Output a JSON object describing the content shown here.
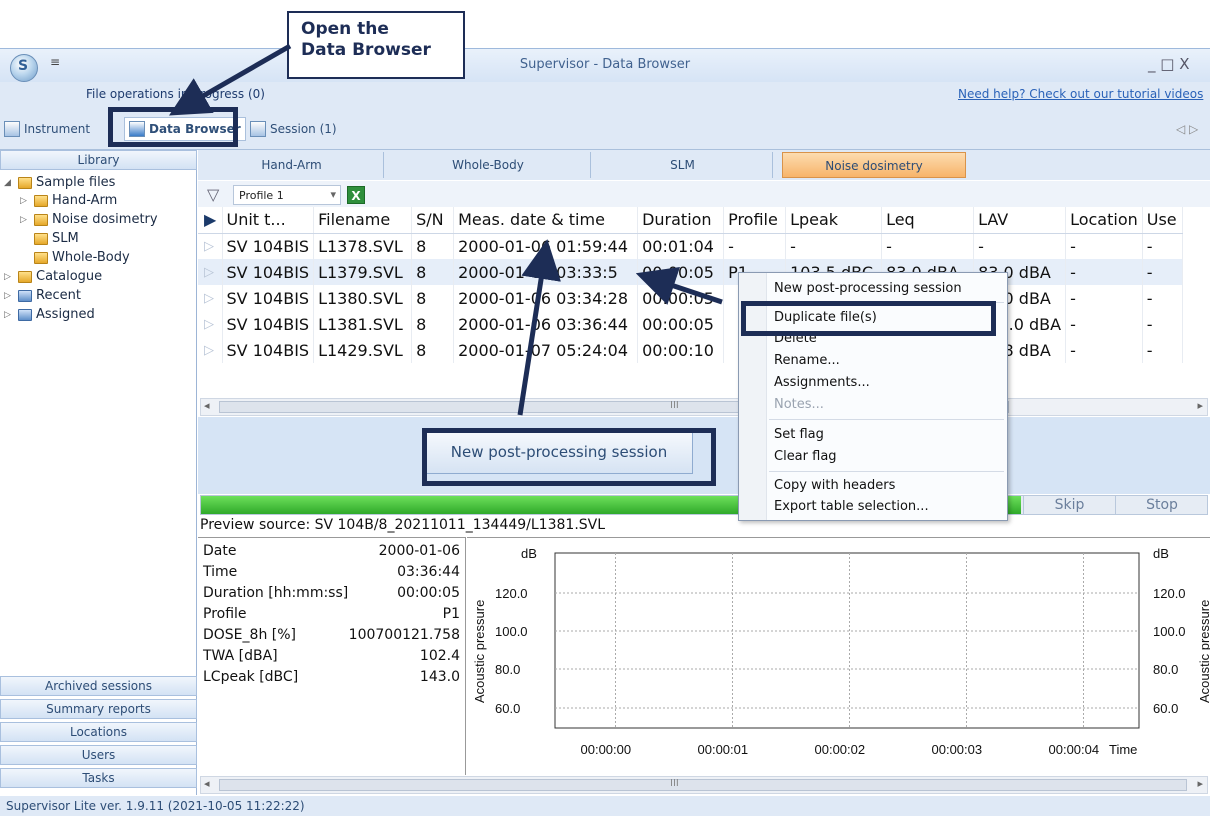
{
  "app": {
    "title": "Supervisor - Data Browser",
    "app_button_glyph": "S",
    "quick_access": "≡",
    "window_controls": "_ □ X",
    "file_operations": "File operations in progress (0)",
    "help_link": "Need help? Check out our tutorial videos",
    "tab_scroll": "◁ ▷"
  },
  "main_tabs": [
    {
      "label": "Instrument"
    },
    {
      "label": "Data Browser"
    },
    {
      "label": "Session (1)"
    }
  ],
  "sidebar": {
    "library_header": "Library",
    "tree": [
      {
        "label": "Sample files",
        "expander": "◢"
      },
      {
        "label": "Hand-Arm",
        "expander": "▷"
      },
      {
        "label": "Noise dosimetry",
        "expander": "▷"
      },
      {
        "label": "SLM",
        "expander": ""
      },
      {
        "label": "Whole-Body",
        "expander": ""
      },
      {
        "label": "Catalogue",
        "expander": "▷"
      },
      {
        "label": "Recent",
        "expander": "▷"
      },
      {
        "label": "Assigned",
        "expander": "▷"
      }
    ],
    "bottom_buttons": [
      "Archived sessions",
      "Summary reports",
      "Locations",
      "Users",
      "Tasks"
    ]
  },
  "category_tabs": [
    "Hand-Arm",
    "Whole-Body",
    "SLM",
    "Noise dosimetry"
  ],
  "toolbar": {
    "profile_value": "Profile 1",
    "filter_icon": "▽",
    "dropdown_arrow": "▾",
    "excel_icon": "X"
  },
  "grid": {
    "headers": [
      "Unit t...",
      "Filename",
      "S/N",
      "Meas. date & time",
      "Duration",
      "Profile",
      "Lpeak",
      "Leq",
      "LAV",
      "Location",
      "Use"
    ],
    "header_flag": "▶",
    "row_flag": "▷",
    "rows": [
      [
        "SV 104BIS",
        "L1378.SVL",
        "8",
        "2000-01-06 01:59:44",
        "00:01:04",
        "-",
        "-",
        "-",
        "-",
        "-",
        "-"
      ],
      [
        "SV 104BIS",
        "L1379.SVL",
        "8",
        "2000-01-06 03:33:5",
        "00:00:05",
        "P1",
        "103.5 dBC",
        "83.0 dBA",
        "83.0 dBA",
        "-",
        "-"
      ],
      [
        "SV 104BIS",
        "L1380.SVL",
        "8",
        "2000-01-06 03:34:28",
        "00:00:05",
        "",
        "",
        "",
        "83.0 dBA",
        "-",
        "-"
      ],
      [
        "SV 104BIS",
        "L1381.SVL",
        "8",
        "2000-01-06 03:36:44",
        "00:00:05",
        "",
        "",
        "",
        "140.0 dBA",
        "-",
        "-"
      ],
      [
        "SV 104BIS",
        "L1429.SVL",
        "8",
        "2000-01-07 05:24:04",
        "00:00:10",
        "",
        "",
        "",
        "88.8 dBA",
        "-",
        "-"
      ]
    ]
  },
  "scrollbar_grip": "III",
  "scroll_left": "◂",
  "scroll_right": "▸",
  "actions": {
    "new_session_button": "New post-processing session",
    "skip": "Skip",
    "stop": "Stop",
    "progress_fraction": 0.815
  },
  "preview": {
    "source": "Preview source: SV 104B/8_20211011_134449/L1381.SVL",
    "rows": [
      {
        "label": "Date",
        "value": "2000-01-06"
      },
      {
        "label": "Time",
        "value": "03:36:44"
      },
      {
        "label": "Duration [hh:mm:ss]",
        "value": "00:00:05"
      },
      {
        "label": "Profile",
        "value": "P1"
      },
      {
        "label": "DOSE_8h [%]",
        "value": "100700121.758"
      },
      {
        "label": "TWA [dBA]",
        "value": "102.4"
      },
      {
        "label": "LCpeak [dBC]",
        "value": "143.0"
      }
    ]
  },
  "chart_data": {
    "type": "line",
    "unit_left": "dB",
    "unit_right": "dB",
    "ylabel": "Acoustic pressure",
    "xlabel": "Time",
    "y_ticks": [
      "120.0",
      "100.0",
      "80.0",
      "60.0"
    ],
    "x_ticks": [
      "00:00:00",
      "00:00:01",
      "00:00:02",
      "00:00:03",
      "00:00:04"
    ],
    "grid": true,
    "series": []
  },
  "context_menu": {
    "items": [
      {
        "label": "New post-processing session",
        "enabled": true
      },
      {
        "label": "Duplicate file(s)",
        "enabled": true
      },
      {
        "label": "Delete",
        "enabled": true
      },
      {
        "label": "Rename...",
        "enabled": true
      },
      {
        "label": "Assignments...",
        "enabled": true
      },
      {
        "label": "Notes...",
        "enabled": false
      },
      {
        "label": "Set flag",
        "enabled": true
      },
      {
        "label": "Clear flag",
        "enabled": true
      },
      {
        "label": "Copy with headers",
        "enabled": true
      },
      {
        "label": "Export table selection...",
        "enabled": true
      }
    ]
  },
  "callout": {
    "line1": "Open the",
    "line2": "Data Browser"
  },
  "status": "Supervisor Lite ver. 1.9.11 (2021-10-05 11:22:22)",
  "colors": {
    "accent_orange": "#f7b46a",
    "callout_navy": "#1d2d56",
    "progress_green": "#3fbe35"
  }
}
